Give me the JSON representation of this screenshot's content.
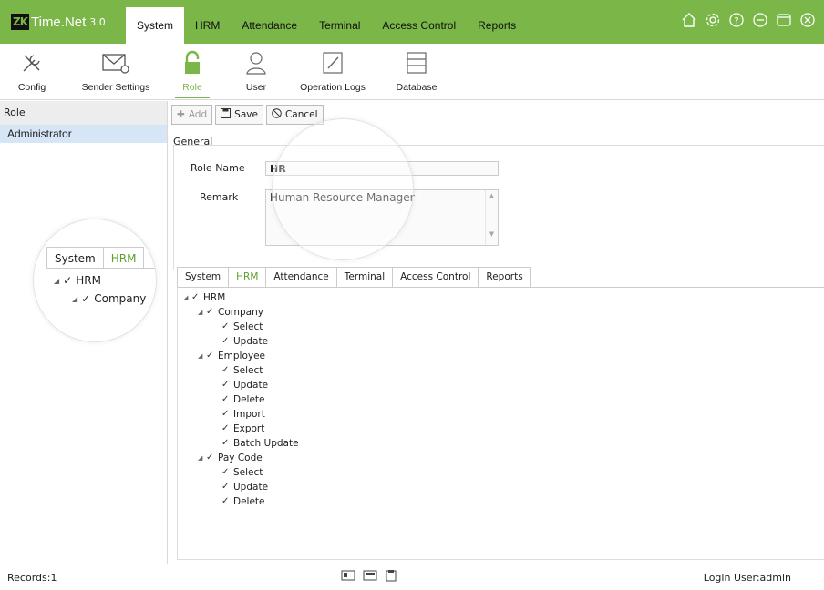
{
  "app": {
    "logo": "ZK",
    "name": "Time.Net",
    "version": "3.0"
  },
  "menu": [
    "System",
    "HRM",
    "Attendance",
    "Terminal",
    "Access Control",
    "Reports"
  ],
  "toolbar": {
    "config": "Config",
    "sender_settings": "Sender Settings",
    "role": "Role",
    "user": "User",
    "operation_logs": "Operation Logs",
    "database": "Database"
  },
  "left": {
    "header": "Role",
    "item": "Administrator"
  },
  "actions": {
    "add": "Add",
    "save": "Save",
    "cancel": "Cancel"
  },
  "general": {
    "section": "General",
    "role_name_label": "Role Name",
    "role_name_value": "HR",
    "remark_label": "Remark",
    "remark_value": "Human Resource Manager"
  },
  "tabs": [
    "System",
    "HRM",
    "Attendance",
    "Terminal",
    "Access Control",
    "Reports"
  ],
  "tree": {
    "root": "HRM",
    "company": "Company",
    "employee": "Employee",
    "pay_code": "Pay Code",
    "select": "Select",
    "update": "Update",
    "delete": "Delete",
    "import": "Import",
    "export": "Export",
    "batch_update": "Batch Update"
  },
  "zoom": {
    "tab_system": "System",
    "tab_hrm": "HRM",
    "root": "HRM",
    "company": "Company"
  },
  "footer": {
    "records": "Records:1",
    "login_user": "Login User:admin"
  },
  "colors": {
    "accent": "#7ab648",
    "selected_row": "#d7e6f7"
  }
}
